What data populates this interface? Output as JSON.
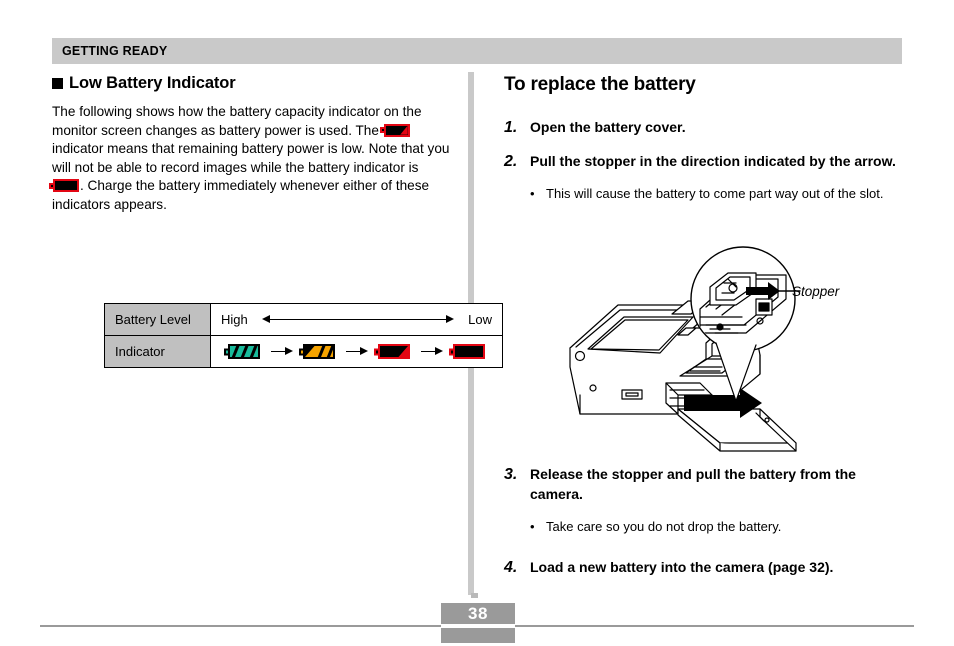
{
  "header": {
    "running_title": "GETTING READY"
  },
  "left": {
    "section_heading": "Low Battery Indicator",
    "paragraph_part1": "The following shows how the battery capacity indicator on the monitor screen changes as battery power is used. The",
    "paragraph_part2": "indicator means that remaining battery power is low. Note that you will not be able to record images while the battery indicator is",
    "paragraph_part3": ". Charge the battery immediately whenever either of these indicators appears.",
    "table": {
      "rows": [
        {
          "label": "Battery Level",
          "high": "High",
          "low": "Low"
        },
        {
          "label": "Indicator"
        }
      ],
      "indicators": [
        {
          "name": "battery-full-icon",
          "color": "#18bb9c",
          "state": "full"
        },
        {
          "name": "battery-medium-icon",
          "color": "#f5a300",
          "state": "medium"
        },
        {
          "name": "battery-low-icon",
          "color": "#e30613",
          "state": "low"
        },
        {
          "name": "battery-empty-icon",
          "color": "#e30613",
          "state": "empty"
        }
      ],
      "arrow_separator": "→"
    }
  },
  "right": {
    "procedure_title": "To replace the battery",
    "steps": [
      {
        "num": "1.",
        "text": "Open the battery cover.",
        "bullets": []
      },
      {
        "num": "2.",
        "text": "Pull the stopper in the direction indicated by the arrow.",
        "bullets": [
          "This will cause the battery to come part way out of the slot."
        ]
      },
      {
        "num": "3.",
        "text": "Release the stopper and pull the battery from the camera.",
        "bullets": [
          "Take care so you do not drop the battery."
        ]
      },
      {
        "num": "4.",
        "text": "Load a new battery into the camera (page 32).",
        "bullets": []
      }
    ],
    "figure": {
      "callout_label": "Stopper",
      "alt": "camera-battery-removal-illustration"
    }
  },
  "footer": {
    "page_number": "38"
  },
  "colors": {
    "header_gray": "#c9c9c9",
    "table_label_gray": "#c0c0c0",
    "footer_gray": "#9a9a9a",
    "battery_green": "#18bb9c",
    "battery_orange": "#f5a300",
    "battery_red": "#e30613"
  }
}
